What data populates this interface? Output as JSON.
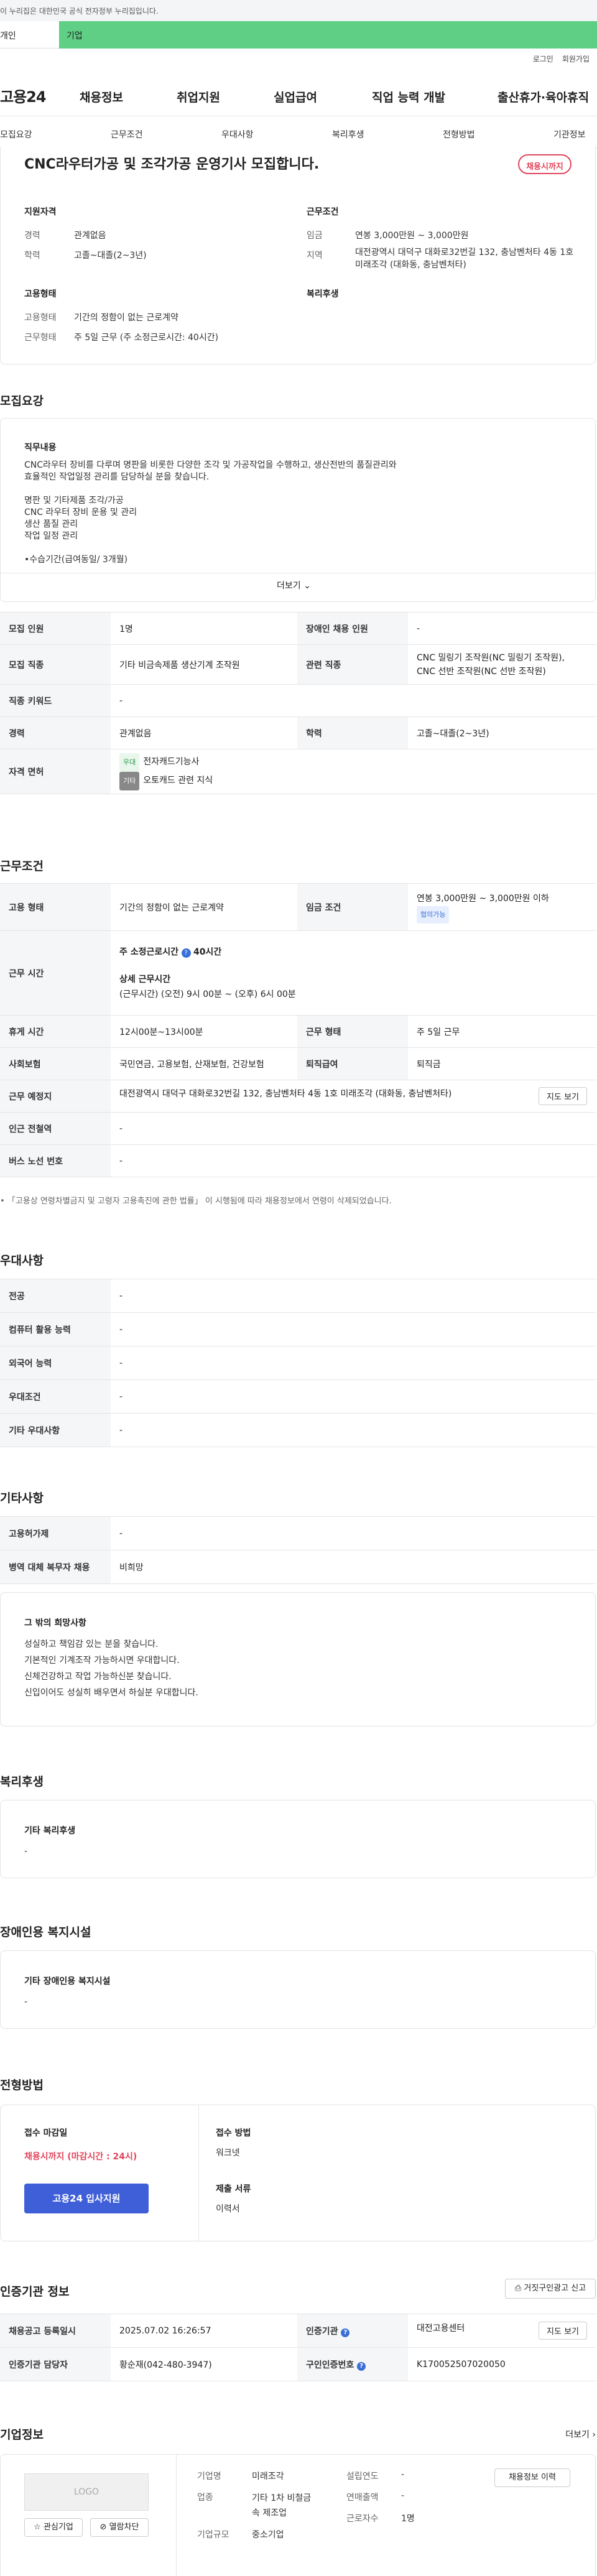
{
  "gov_bar": {
    "text": "이 누리집은 대한민국 공식 전자정부 누리집입니다."
  },
  "top_tabs": {
    "person": "개인",
    "company": "기업"
  },
  "utils": {
    "login": "로그인",
    "signup": "회원가입"
  },
  "logo": "고용24",
  "gnb": [
    "채용정보",
    "취업지원",
    "실업급여",
    "직업 능력 개발",
    "출산휴가·육아휴직"
  ],
  "subnav": [
    "모집요강",
    "근무조건",
    "우대사항",
    "복리후생",
    "전형방법",
    "기관정보"
  ],
  "header": {
    "title": "CNC라우터가공 및 조각가공 운영기사 모집합니다.",
    "status": "채용시까지",
    "qual_h": "지원자격",
    "career_l": "경력",
    "career_v": "관계없음",
    "edu_l": "학력",
    "edu_v": "고졸~대졸(2~3년)",
    "cond_h": "근무조건",
    "wage_l": "임금",
    "wage_v": "연봉 3,000만원 ~ 3,000만원",
    "region_l": "지역",
    "region_v": "대전광역시 대덕구 대화로32번길 132, 충남벤처타 4동 1호 미래조각 (대화동, 충남벤처타)",
    "emp_h": "고용형태",
    "type_l": "고용형태",
    "type_v": "기간의 정함이 없는 근로계약",
    "shape_l": "근무형태",
    "shape_v": "주 5일 근무 (주 소정근로시간: 40시간)",
    "welfare_h": "복리후생"
  },
  "recruit": {
    "heading": "모집요강",
    "duty_h": "직무내용",
    "duty_lines": [
      "CNC라우터 장비를 다루며 명판을 비롯한 다양한 조각 및 가공작업을 수행하고, 생산전반의 품질관리와",
      "효율적인 작업일정 관리를 담당하실 분을 찾습니다.",
      "",
      "명판 및 기타제품 조각/가공",
      "CNC 라우터 장비 운용 및 관리",
      "생산 품질 관리",
      "작업 일정 관리",
      "",
      "•수습기간(급여동일/ 3개월)"
    ],
    "more": "더보기",
    "rows": [
      {
        "l1": "모집 인원",
        "v1": "1명",
        "l2": "장애인 채용 인원",
        "v2": "-"
      },
      {
        "l1": "모집 직종",
        "v1": "기타 비금속제품 생산기계 조작원",
        "l2": "관련 직종",
        "v2a": "CNC 밀링기 조작원(NC 밀링기 조작원),",
        "v2b": "CNC 선반 조작원(NC 선반 조작원)"
      },
      {
        "l1": "직종 키워드",
        "v1": "-"
      },
      {
        "l1": "경력",
        "v1": "관계없음",
        "l2": "학력",
        "v2": "고졸~대졸(2~3년)"
      },
      {
        "l1": "자격 면허",
        "v1a": "전자캐드기능사",
        "b1": "우대",
        "v1b": "오토캐드 관련 지식",
        "b2": "기타"
      }
    ]
  },
  "work": {
    "heading": "근무조건",
    "type_l": "고용 형태",
    "type_v": "기간의 정함이 없는 근로계약",
    "wage_l": "임금 조건",
    "wage_v": "연봉 3,000만원 ~ 3,000만원 이하",
    "wage_tag": "협의가능",
    "hours_l": "근무 시간",
    "hours_t": "주 소정근로시간",
    "hours_v": "40시간",
    "detail_t": "상세 근무시간",
    "detail_v": "(근무시간) (오전) 9시 00분 ~ (오후) 6시 00분",
    "break_l": "휴게 시간",
    "break_v": "12시00분~13시00분",
    "shape_l": "근무 형태",
    "shape_v": "주 5일 근무",
    "ins_l": "사회보험",
    "ins_v": "국민연금, 고용보험, 산재보험, 건강보험",
    "retire_l": "퇴직급여",
    "retire_v": "퇴직금",
    "place_l": "근무 예정지",
    "place_v": "대전광역시 대덕구 대화로32번길 132, 충남벤처타 4동 1호 미래조각 (대화동, 충남벤처타)",
    "map": "지도 보기",
    "subway_l": "인근 전철역",
    "subway_v": "-",
    "bus_l": "버스 노선 번호",
    "bus_v": "-",
    "note": "「고용상 연령차별금지 및 고령자 고용촉진에 관한 법률」 이 시행됨에 따라 채용정보에서 연령이 삭제되었습니다."
  },
  "pref": {
    "heading": "우대사항",
    "rows": [
      [
        "전공",
        "-"
      ],
      [
        "컴퓨터 활용 능력",
        "-"
      ],
      [
        "외국어 능력",
        "-"
      ],
      [
        "우대조건",
        "-"
      ],
      [
        "기타 우대사항",
        "-"
      ]
    ]
  },
  "etc": {
    "heading": "기타사항",
    "rows": [
      [
        "고용허가제",
        "-"
      ],
      [
        "병역 대체 복무자 채용",
        "비희망"
      ]
    ],
    "wish_h": "그 밖의 희망사항",
    "wish_lines": [
      "성실하고 책임감 있는 분을 찾습니다.",
      "기본적인 기계조작 가능하시면 우대합니다.",
      "신체건강하고 작업 가능하신분 찾습니다.",
      "신입이어도 성실히 배우면서 하실분 우대합니다."
    ]
  },
  "benefit": {
    "heading": "복리후생",
    "sub": "기타 복리후생",
    "val": "-"
  },
  "disab": {
    "heading": "장애인용 복지시설",
    "sub": "기타 장애인용 복지시설",
    "val": "-"
  },
  "select": {
    "heading": "전형방법",
    "deadline_h": "접수 마감일",
    "deadline_v": "채용시까지 (마감시간 : 24시)",
    "apply": "고용24 입사지원",
    "method_h": "접수 방법",
    "method_v": "워크넷",
    "docs_h": "제출 서류",
    "docs_v": "이력서"
  },
  "agency": {
    "heading": "인증기관 정보",
    "report": "거짓구인광고 신고",
    "reg_l": "채용공고 등록일시",
    "reg_v": "2025.07.02 16:26:57",
    "org_l": "인증기관",
    "org_v": "대전고용센터",
    "map": "지도 보기",
    "mgr_l": "인증기관 담당자",
    "mgr_v": "황순재(042-480-3947)",
    "num_l": "구인인증번호",
    "num_v": "K170052507020050"
  },
  "company": {
    "heading": "기업정보",
    "more": "더보기",
    "logo": "LOGO",
    "fav": "관심기업",
    "block": "열람차단",
    "name_l": "기업명",
    "name_v": "미래조각",
    "ind_l": "업종",
    "ind_v1": "기타 1차 비철금",
    "ind_v2": "속 제조업",
    "size_l": "기업규모",
    "size_v": "중소기업",
    "year_l": "설립연도",
    "year_v": "-",
    "sales_l": "연매출액",
    "sales_v": "-",
    "emp_l": "근로자수",
    "emp_v": "1명",
    "jobs": "채용정보 이력"
  }
}
